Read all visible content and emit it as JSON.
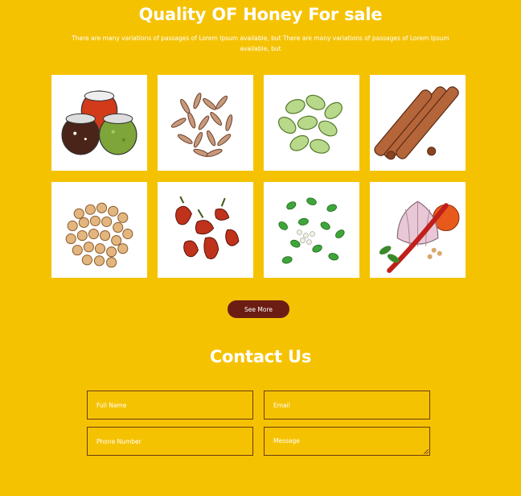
{
  "header": {
    "title": "Quality OF Honey For sale",
    "subtitle": "There are many variations of passages of Lorem Ipsum available, but There are many variations of passages of Lorem Ipsum available, but"
  },
  "products": [
    {
      "icon": "spice-jars-icon"
    },
    {
      "icon": "cumin-seeds-icon"
    },
    {
      "icon": "cardamom-pods-icon"
    },
    {
      "icon": "cinnamon-sticks-icon"
    },
    {
      "icon": "coriander-seeds-icon"
    },
    {
      "icon": "red-chilies-icon"
    },
    {
      "icon": "fenugreek-leaves-icon"
    },
    {
      "icon": "garlic-chili-onion-icon"
    }
  ],
  "see_more_label": "See More",
  "contact": {
    "title": "Contact Us",
    "full_name_placeholder": "Full Name",
    "email_placeholder": "Email",
    "phone_placeholder": "Phone Number",
    "message_placeholder": "Message"
  },
  "colors": {
    "background": "#f5c202",
    "button": "#6b1d13",
    "text": "#ffffff"
  }
}
